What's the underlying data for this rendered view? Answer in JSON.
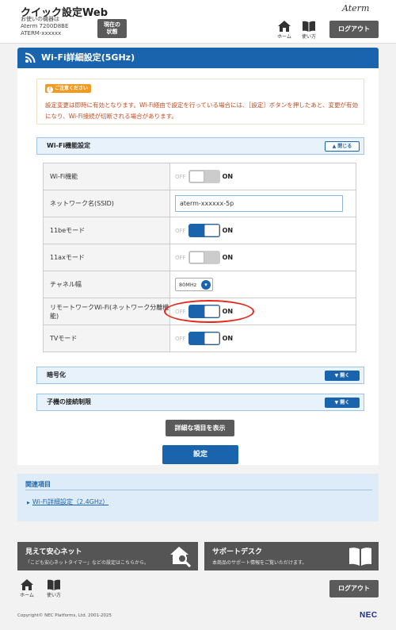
{
  "header": {
    "app_title": "クイック設定Web",
    "device_line1": "お使いの機器は",
    "device_line2": "Aterm 7200D8BE",
    "device_line3": "ATERM-xxxxxx",
    "status_button_line1": "現在の",
    "status_button_line2": "状態",
    "brand": "Aterm",
    "home_label": "ホーム",
    "manual_label": "使い方",
    "logout_label": "ログアウト"
  },
  "page": {
    "title": "Wi-Fi詳細設定(5GHz)"
  },
  "notice": {
    "badge": "ご注意ください",
    "badge_icon": "!",
    "text": "設定変更は即時に有効となります。Wi-Fi経由で設定を行っている場合には、［設定］ボタンを押したあと、変更が有効になり、Wi-Fi接続が切断される場合があります。"
  },
  "wifi_function": {
    "section_label": "Wi-Fi機能設定",
    "close_label": "閉じる",
    "off_text": "OFF",
    "on_text": "ON",
    "rows": [
      {
        "label": "Wi-Fi機能",
        "type": "switch",
        "state": "off"
      },
      {
        "label": "ネットワーク名(SSID)",
        "type": "text",
        "value": "aterm-xxxxxx-5p"
      },
      {
        "label": "11beモード",
        "type": "switch",
        "state": "on"
      },
      {
        "label": "11axモード",
        "type": "switch",
        "state": "off"
      },
      {
        "label": "チャネル幅",
        "type": "select",
        "value": "80MHz"
      },
      {
        "label": "リモートワークWi-Fi(ネットワーク分離機能)",
        "type": "switch",
        "state": "on"
      },
      {
        "label": "TVモード",
        "type": "switch",
        "state": "on"
      }
    ]
  },
  "encryption": {
    "section_label": "暗号化",
    "open_label": "開く"
  },
  "access_limit": {
    "section_label": "子機の接続制限",
    "open_label": "開く"
  },
  "actions": {
    "detail_label": "詳細な項目を表示",
    "submit_label": "設定"
  },
  "related": {
    "title": "関連項目",
    "link_label": "Wi-Fi詳細設定（2.4GHz）"
  },
  "banners": {
    "safety_title": "見えて安心ネット",
    "safety_sub": "「こども安心ネットタイマー」などの設定はこちらから。",
    "support_title": "サポートデスク",
    "support_sub": "本商品のサポート情報をご覧いただけます。"
  },
  "footer": {
    "home_label": "ホーム",
    "manual_label": "使い方",
    "logout_label": "ログアウト",
    "copyright": "Copyright© NEC Platforms, Ltd. 2001-2025",
    "logo": "NEC"
  },
  "colors": {
    "accent": "#1a64ae",
    "notice_text": "#c24b1e",
    "badge": "#f29a1e",
    "highlight": "#e8261a"
  }
}
